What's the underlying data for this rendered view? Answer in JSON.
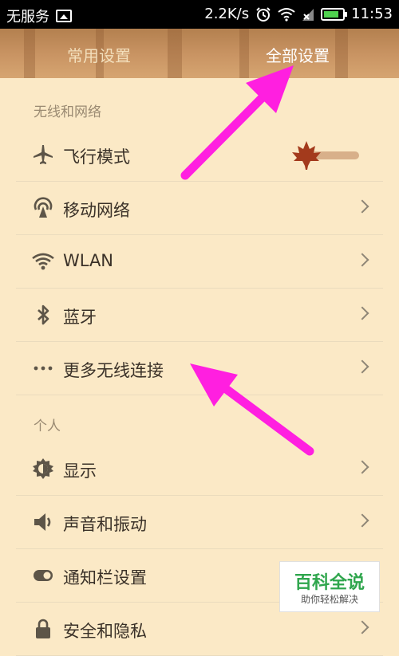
{
  "status_bar": {
    "carrier": "无服务",
    "speed": "2.2K/s",
    "time": "11:53"
  },
  "tabs": [
    {
      "label": "常用设置",
      "active": false
    },
    {
      "label": "全部设置",
      "active": true
    }
  ],
  "sections": [
    {
      "title": "无线和网络"
    },
    {
      "title": "个人"
    }
  ],
  "items": [
    {
      "label": "飞行模式",
      "icon": "airplane-icon",
      "control": "toggle",
      "toggle_on": false
    },
    {
      "label": "移动网络",
      "icon": "cellular-icon"
    },
    {
      "label": "WLAN",
      "icon": "wifi-icon"
    },
    {
      "label": "蓝牙",
      "icon": "bluetooth-icon"
    },
    {
      "label": "更多无线连接",
      "icon": "more-dots-icon"
    },
    {
      "label": "显示",
      "icon": "brightness-icon"
    },
    {
      "label": "声音和振动",
      "icon": "speaker-icon"
    },
    {
      "label": "通知栏设置",
      "icon": "notification-toggle-icon"
    },
    {
      "label": "安全和隐私",
      "icon": "lock-icon"
    }
  ],
  "watermark": {
    "title": "百科全说",
    "subtitle": "助你轻松解决"
  },
  "colors": {
    "background": "#fbe9c6",
    "annotation_arrow": "#ff1fe0",
    "toggle_leaf": "#a33a1c"
  }
}
